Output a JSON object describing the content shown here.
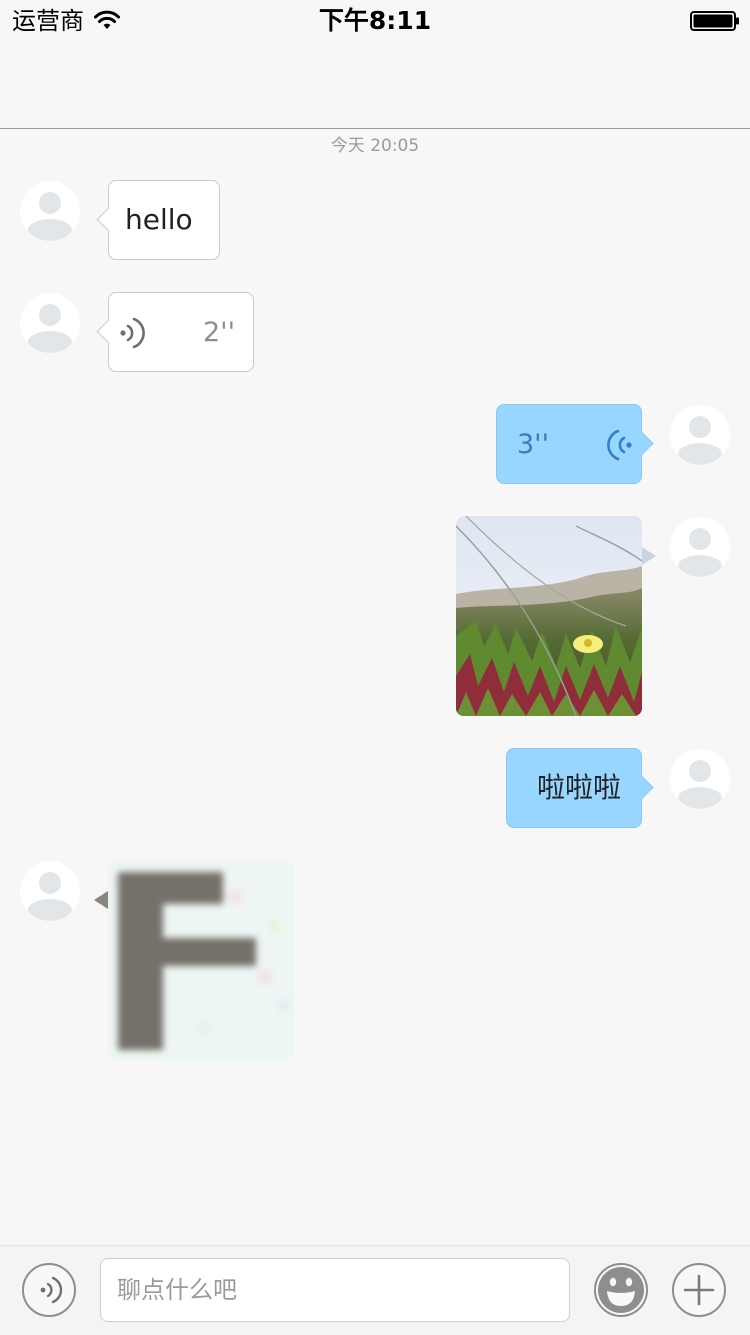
{
  "status_bar": {
    "carrier": "运营商",
    "time": "下午8:11"
  },
  "chat": {
    "timestamp": "今天 20:05",
    "messages": [
      {
        "direction": "incoming",
        "type": "text",
        "text": "hello"
      },
      {
        "direction": "incoming",
        "type": "voice",
        "duration": "2''"
      },
      {
        "direction": "outgoing",
        "type": "voice",
        "duration": "3''"
      },
      {
        "direction": "outgoing",
        "type": "image",
        "subject": "flower-photo"
      },
      {
        "direction": "outgoing",
        "type": "text",
        "text": "啦啦啦"
      },
      {
        "direction": "incoming",
        "type": "image",
        "subject": "blurry-letter-image"
      }
    ]
  },
  "input_bar": {
    "placeholder": "聊点什么吧",
    "voice_button_icon": "voice-icon",
    "emoji_button_icon": "emoji-icon",
    "more_button_icon": "plus-icon"
  },
  "colors": {
    "background": "#f7f7f7",
    "outgoing_bubble": "#99d6ff",
    "incoming_bubble": "#ffffff",
    "outgoing_voice_icon": "#2f7fc9"
  }
}
